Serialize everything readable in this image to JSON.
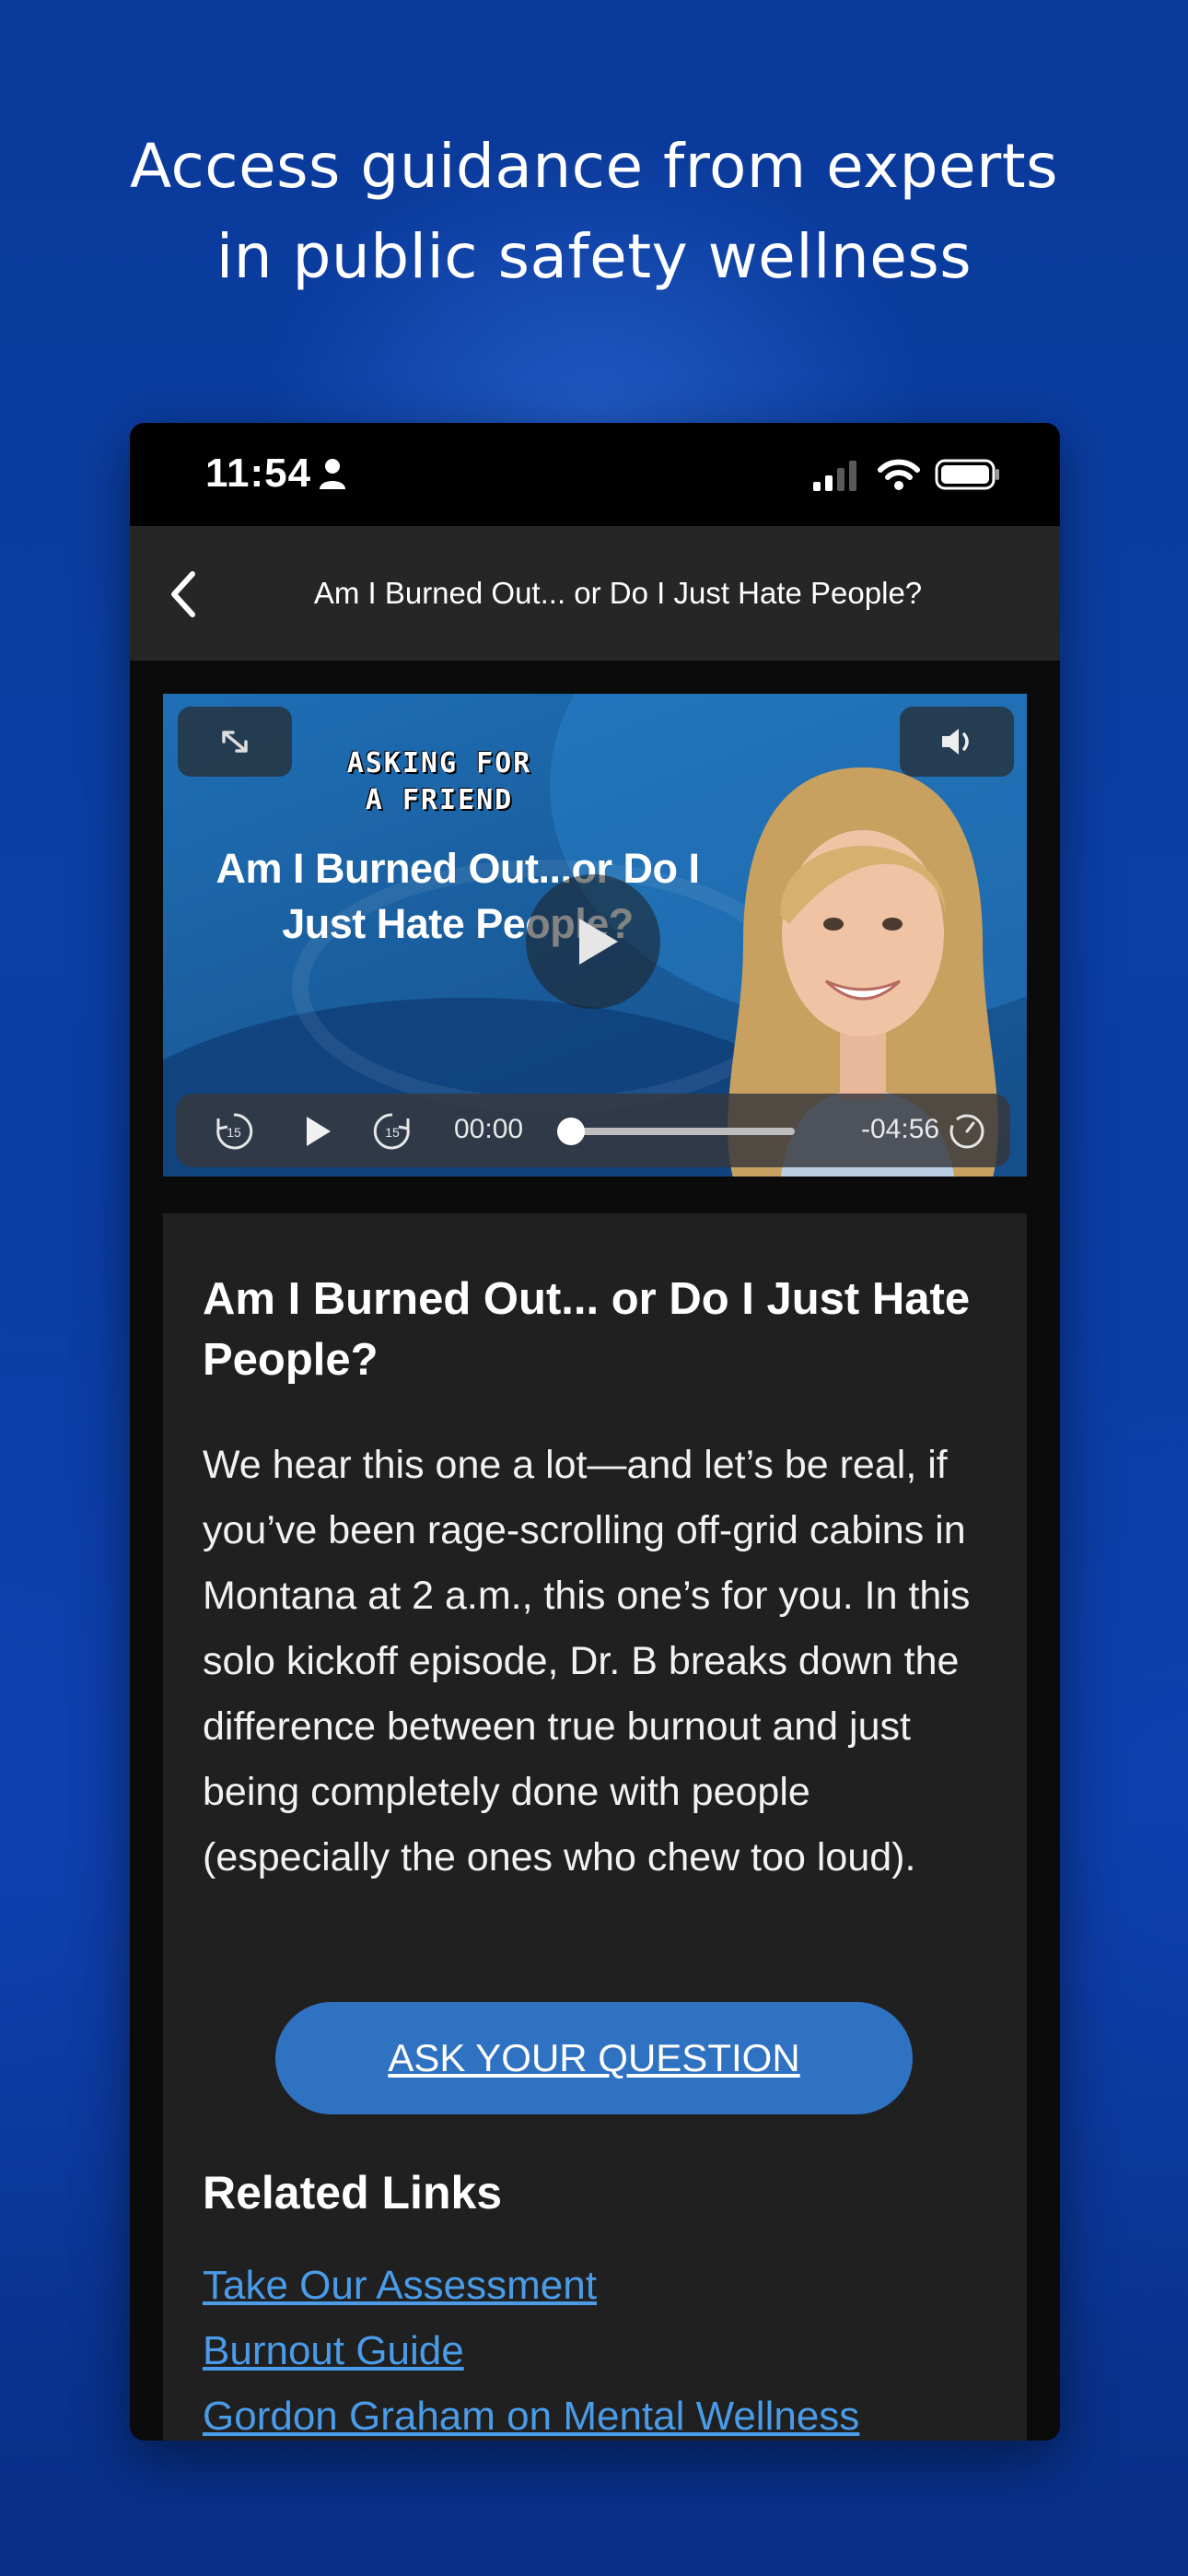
{
  "headline": {
    "line1": "Access guidance from experts",
    "line2": "in public safety wellness"
  },
  "status_bar": {
    "time": "11:54",
    "icons": [
      "person-icon",
      "cellular-signal-icon",
      "wifi-icon",
      "battery-icon"
    ]
  },
  "nav": {
    "back_icon": "chevron-left-icon",
    "title": "Am I Burned Out... or Do I Just Hate People?"
  },
  "video": {
    "show_logo_line1": "ASKING FOR",
    "show_logo_line2": "A FRIEND",
    "thumbnail_title_line1": "Am I Burned Out...or Do I",
    "thumbnail_title_line2": "Just Hate People?",
    "elapsed": "00:00",
    "remaining": "-04:56",
    "progress": 0.0,
    "skip_back_label": "15",
    "skip_forward_label": "15"
  },
  "episode": {
    "title": "Am I Burned Out... or Do I Just Hate People?",
    "description": "We hear this one a lot—and let’s be real, if you’ve been rage-scrolling off-grid cabins in Montana at 2 a.m., this one’s for you. In this solo kickoff episode, Dr. B breaks down the difference between true burnout and just being completely done with people (especially the ones who chew too loud).",
    "ask_button": "ASK YOUR QUESTION"
  },
  "related": {
    "heading": "Related Links",
    "links": [
      "Take Our Assessment",
      "Burnout Guide",
      "Gordon Graham on Mental Wellness"
    ]
  },
  "colors": {
    "background": "#0b3fa6",
    "accent_button": "#2f72c2",
    "link": "#4a9be8",
    "card": "#202020",
    "navbar": "#262626"
  }
}
